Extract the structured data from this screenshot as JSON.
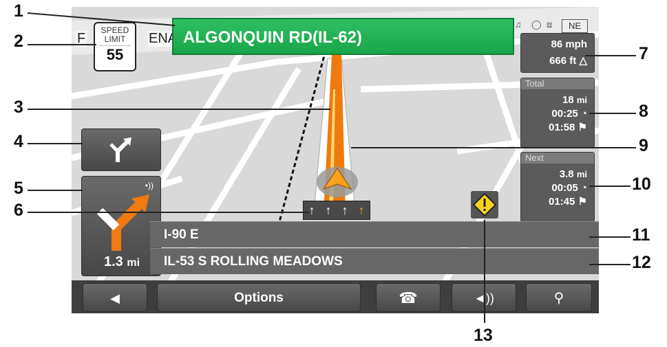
{
  "street": {
    "current": "ALGONQUIN RD(IL-62)",
    "map_fragment_left": "F",
    "map_fragment_right": "ENA"
  },
  "speed_limit": {
    "line1": "SPEED",
    "line2": "LIMIT",
    "value": "55"
  },
  "status": {
    "compass": "NE"
  },
  "speed_panel": {
    "speed": "86 mph",
    "altitude": "666 ft"
  },
  "total_panel": {
    "header": "Total",
    "distance": "18",
    "distance_unit": "mi",
    "time": "00:25",
    "arrival": "01:58"
  },
  "next_panel": {
    "header": "Next",
    "distance": "3.8",
    "distance_unit": "mi",
    "time": "00:05",
    "arrival": "01:45"
  },
  "maneuver": {
    "distance": "1.3",
    "unit": "mi"
  },
  "roads": {
    "line1": "I-90 E",
    "line2": "IL-53 S ROLLING MEADOWS"
  },
  "bottom_bar": {
    "options_label": "Options"
  },
  "callouts": [
    "1",
    "2",
    "3",
    "4",
    "5",
    "6",
    "7",
    "8",
    "9",
    "10",
    "11",
    "12",
    "13"
  ],
  "colors": {
    "route": "#f07a10",
    "streetbar": "#22b04f",
    "panel": "#5b5b5b"
  }
}
